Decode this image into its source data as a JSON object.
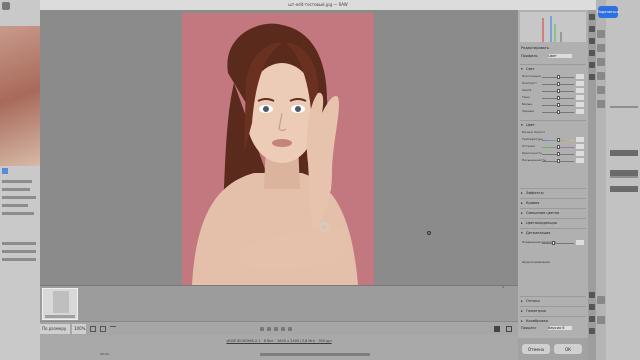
{
  "dialog": {
    "title": "шт-edit-тестовый.jpg  —  RAW"
  },
  "canvas": {
    "zoom_label": "По размеру (75,8%)",
    "zoom_percent": "100%"
  },
  "status": {
    "file_info": "sRGB IEC61966-2.1 · 8 бит · 1600 x 2400 (3,8 Мп) · 300 ppi",
    "left": "99,4%"
  },
  "panel": {
    "title": "Редактировать",
    "profile_label": "Профиль",
    "profile_value": "Цвет",
    "sections": {
      "light": "Свет",
      "color": "Цвет",
      "effects": "Эффекты",
      "curve": "Кривая",
      "mixing": "Смешение цветов",
      "grading": "Цветокоррекция",
      "detail": "Детализация",
      "optics": "Оптика",
      "geometry": "Геометрия",
      "calibration": "Калибровка"
    },
    "light_sliders": [
      "Экспозиция",
      "Контраст",
      "Света",
      "Тени",
      "Белые",
      "Черные"
    ],
    "color_sliders": [
      "Баланс белого",
      "Температура",
      "Оттенок",
      "Красочность",
      "Насыщенность"
    ],
    "detail_label": "Повышение резкости",
    "noise_label": "Шумоподавление",
    "calibration_label": "Процесс",
    "calibration_value": "Версия 6"
  },
  "buttons": {
    "cancel": "Отмена",
    "ok": "ОК",
    "share": "Поделиться"
  },
  "colors": {
    "backdrop": "#c3777e",
    "hair": "#5a2a1c",
    "skin": "#e9c9b4"
  }
}
